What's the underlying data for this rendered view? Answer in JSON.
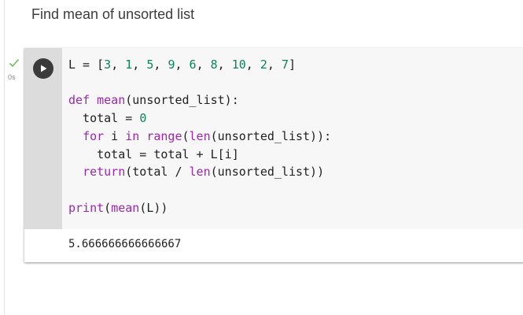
{
  "text_cell": {
    "title": "Find mean of unsorted list"
  },
  "code_cell": {
    "status_time": "0s",
    "lines": [
      {
        "tokens": [
          {
            "t": "L = [",
            "c": "op"
          },
          {
            "t": "3",
            "c": "num"
          },
          {
            "t": ", ",
            "c": "op"
          },
          {
            "t": "1",
            "c": "num"
          },
          {
            "t": ", ",
            "c": "op"
          },
          {
            "t": "5",
            "c": "num"
          },
          {
            "t": ", ",
            "c": "op"
          },
          {
            "t": "9",
            "c": "num"
          },
          {
            "t": ", ",
            "c": "op"
          },
          {
            "t": "6",
            "c": "num"
          },
          {
            "t": ", ",
            "c": "op"
          },
          {
            "t": "8",
            "c": "num"
          },
          {
            "t": ", ",
            "c": "op"
          },
          {
            "t": "10",
            "c": "num"
          },
          {
            "t": ", ",
            "c": "op"
          },
          {
            "t": "2",
            "c": "num"
          },
          {
            "t": ", ",
            "c": "op"
          },
          {
            "t": "7",
            "c": "num"
          },
          {
            "t": "]",
            "c": "op"
          }
        ]
      },
      {
        "tokens": []
      },
      {
        "tokens": [
          {
            "t": "def",
            "c": "purple"
          },
          {
            "t": " ",
            "c": "op"
          },
          {
            "t": "mean",
            "c": "purple"
          },
          {
            "t": "(unsorted_list):",
            "c": "op"
          }
        ]
      },
      {
        "tokens": [
          {
            "t": "  total = ",
            "c": "op"
          },
          {
            "t": "0",
            "c": "num"
          }
        ]
      },
      {
        "tokens": [
          {
            "t": "  ",
            "c": "op"
          },
          {
            "t": "for",
            "c": "purple"
          },
          {
            "t": " i ",
            "c": "op"
          },
          {
            "t": "in",
            "c": "purple"
          },
          {
            "t": " ",
            "c": "op"
          },
          {
            "t": "range",
            "c": "purple"
          },
          {
            "t": "(",
            "c": "op"
          },
          {
            "t": "len",
            "c": "purple"
          },
          {
            "t": "(unsorted_list)):",
            "c": "op"
          }
        ]
      },
      {
        "tokens": [
          {
            "t": "    total = total + L[i]",
            "c": "op"
          }
        ]
      },
      {
        "tokens": [
          {
            "t": "  ",
            "c": "op"
          },
          {
            "t": "return",
            "c": "purple"
          },
          {
            "t": "(total / ",
            "c": "op"
          },
          {
            "t": "len",
            "c": "purple"
          },
          {
            "t": "(unsorted_list))",
            "c": "op"
          }
        ]
      },
      {
        "tokens": []
      },
      {
        "tokens": [
          {
            "t": "print",
            "c": "purple"
          },
          {
            "t": "(",
            "c": "op"
          },
          {
            "t": "mean",
            "c": "purple"
          },
          {
            "t": "(L))",
            "c": "op"
          }
        ]
      }
    ],
    "output": "5.666666666666667"
  },
  "colors": {
    "keyword": "#9c27b0",
    "number": "#098658",
    "text": "#212121",
    "success_check": "#6bbf59",
    "run_button": "#3b3b3b"
  },
  "icons": {
    "run": "play-icon",
    "status": "check-icon"
  }
}
